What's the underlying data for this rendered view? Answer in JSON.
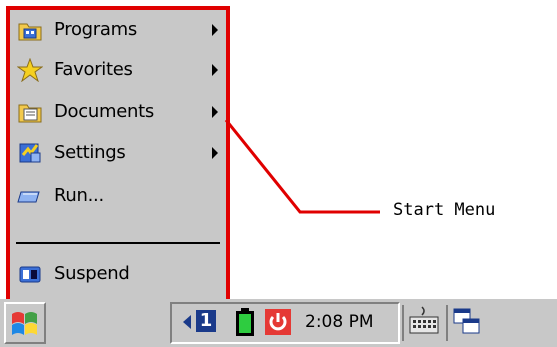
{
  "menu": {
    "items": [
      {
        "label": "Programs",
        "icon": "programs-folder-icon",
        "submenu": true
      },
      {
        "label": "Favorites",
        "icon": "favorites-star-icon",
        "submenu": true
      },
      {
        "label": "Documents",
        "icon": "documents-folder-icon",
        "submenu": true
      },
      {
        "label": "Settings",
        "icon": "settings-icon",
        "submenu": true
      },
      {
        "label": "Run...",
        "icon": "run-icon",
        "submenu": false
      },
      {
        "label": "Suspend",
        "icon": "suspend-icon",
        "submenu": false
      }
    ],
    "highlight_color": "#e00000"
  },
  "callout": {
    "label": "Start Menu",
    "line_color": "#e00000"
  },
  "taskbar": {
    "start_icon": "windows-flag-icon",
    "input_indicator": "1",
    "battery_icon": "battery-icon",
    "power_icon": "power-icon",
    "clock": "2:08 PM",
    "keyboard_icon": "keyboard-icon",
    "desktop_icon": "windows-switch-icon"
  }
}
